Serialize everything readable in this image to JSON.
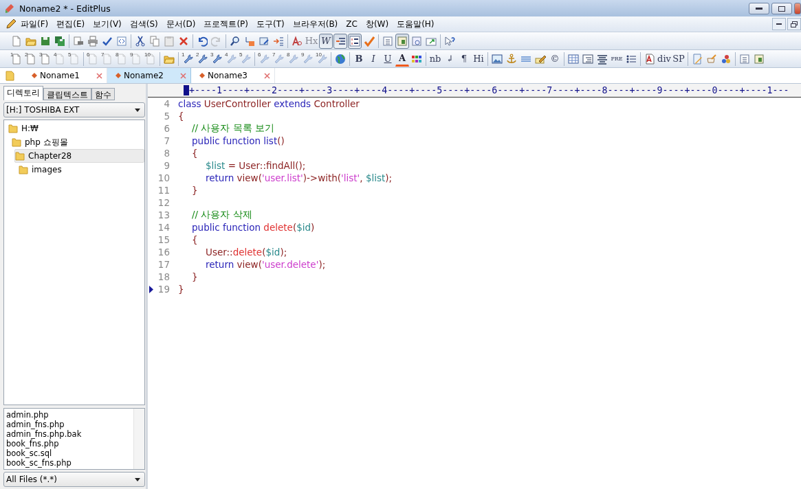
{
  "window": {
    "title": "Noname2 * - EditPlus"
  },
  "menu": [
    "파일(F)",
    "편집(E)",
    "보기(V)",
    "검색(S)",
    "문서(D)",
    "프로젝트(P)",
    "도구(T)",
    "브라우저(B)",
    "ZC",
    "창(W)",
    "도움말(H)"
  ],
  "toolbars": [
    {
      "items": [
        {
          "kind": "icon"
        },
        {
          "kind": "icon"
        },
        {
          "kind": "icon"
        },
        {
          "kind": "icon"
        },
        {
          "kind": "separator"
        },
        {
          "kind": "icon"
        },
        {
          "kind": "icon"
        },
        {
          "kind": "icon"
        },
        {
          "kind": "icon"
        },
        {
          "kind": "separator"
        },
        {
          "kind": "icon"
        },
        {
          "kind": "icon"
        },
        {
          "kind": "icon"
        },
        {
          "kind": "icon"
        },
        {
          "kind": "separator"
        },
        {
          "kind": "icon"
        },
        {
          "kind": "icon",
          "disabled": true
        },
        {
          "kind": "separator"
        },
        {
          "kind": "icon"
        },
        {
          "kind": "icon"
        },
        {
          "kind": "icon"
        },
        {
          "kind": "icon"
        },
        {
          "kind": "separator"
        },
        {
          "kind": "icon"
        },
        {
          "kind": "text",
          "label": "Hx",
          "disabled": true
        },
        {
          "kind": "italic",
          "label": "W",
          "pressed": true
        },
        {
          "kind": "icon",
          "pressed": true
        },
        {
          "kind": "icon",
          "pressed": true
        },
        {
          "kind": "icon"
        },
        {
          "kind": "separator"
        },
        {
          "kind": "icon"
        },
        {
          "kind": "icon",
          "pressed": true
        },
        {
          "kind": "icon"
        },
        {
          "kind": "icon"
        },
        {
          "kind": "separator"
        },
        {
          "kind": "icon"
        }
      ]
    },
    {
      "items": [
        {
          "kind": "numbered",
          "label": "1"
        },
        {
          "kind": "numbered",
          "label": "2"
        },
        {
          "kind": "numbered",
          "label": "3"
        },
        {
          "kind": "numbered",
          "label": "4",
          "disabled": true
        },
        {
          "kind": "numbered",
          "label": "5",
          "disabled": true
        },
        {
          "kind": "separator"
        },
        {
          "kind": "numbered",
          "label": "6",
          "disabled": true
        },
        {
          "kind": "numbered",
          "label": "7",
          "disabled": true
        },
        {
          "kind": "numbered",
          "label": "8",
          "disabled": true
        },
        {
          "kind": "numbered",
          "label": "9",
          "disabled": true
        },
        {
          "kind": "numbered",
          "label": "10",
          "disabled": true
        },
        {
          "kind": "separator"
        },
        {
          "kind": "icon"
        },
        {
          "kind": "separator"
        },
        {
          "kind": "numbered",
          "label": "1"
        },
        {
          "kind": "numbered",
          "label": "2"
        },
        {
          "kind": "numbered",
          "label": "3"
        },
        {
          "kind": "numbered",
          "label": "4",
          "disabled": true
        },
        {
          "kind": "numbered",
          "label": "5",
          "disabled": true
        },
        {
          "kind": "separator"
        },
        {
          "kind": "numbered",
          "label": "6",
          "disabled": true
        },
        {
          "kind": "numbered",
          "label": "7",
          "disabled": true
        },
        {
          "kind": "numbered",
          "label": "8",
          "disabled": true
        },
        {
          "kind": "numbered",
          "label": "9",
          "disabled": true
        },
        {
          "kind": "numbered",
          "label": "10",
          "disabled": true
        },
        {
          "kind": "separator"
        },
        {
          "kind": "icon"
        },
        {
          "kind": "separator"
        },
        {
          "kind": "bold",
          "label": "B"
        },
        {
          "kind": "italic",
          "label": "I"
        },
        {
          "kind": "underline",
          "label": "U"
        },
        {
          "kind": "fontcolor",
          "label": "A"
        },
        {
          "kind": "icon"
        },
        {
          "kind": "separator"
        },
        {
          "kind": "text",
          "label": "nb"
        },
        {
          "kind": "text",
          "label": "↲"
        },
        {
          "kind": "text",
          "label": "¶"
        },
        {
          "kind": "text",
          "label": "Hi"
        },
        {
          "kind": "separator"
        },
        {
          "kind": "icon"
        },
        {
          "kind": "icon"
        },
        {
          "kind": "icon"
        },
        {
          "kind": "icon"
        },
        {
          "kind": "text",
          "label": "©"
        },
        {
          "kind": "separator"
        },
        {
          "kind": "icon"
        },
        {
          "kind": "icon"
        },
        {
          "kind": "icon"
        },
        {
          "kind": "small",
          "label": "PRE"
        },
        {
          "kind": "icon"
        },
        {
          "kind": "separator"
        },
        {
          "kind": "icon"
        },
        {
          "kind": "text",
          "label": "div"
        },
        {
          "kind": "text",
          "label": "SP"
        },
        {
          "kind": "separator"
        },
        {
          "kind": "icon"
        },
        {
          "kind": "icon"
        },
        {
          "kind": "icon"
        },
        {
          "kind": "separator"
        },
        {
          "kind": "icon"
        },
        {
          "kind": "icon"
        }
      ]
    }
  ],
  "doc_tabs": [
    {
      "label": "Noname1",
      "selected": false
    },
    {
      "label": "Noname2",
      "selected": true
    },
    {
      "label": "Noname3",
      "selected": false
    }
  ],
  "sidebar": {
    "tabs": [
      {
        "label": "디렉토리",
        "selected": true
      },
      {
        "label": "클립텍스트",
        "selected": false
      },
      {
        "label": "함수",
        "selected": false
      }
    ],
    "drive": "[H:] TOSHIBA EXT",
    "tree": [
      {
        "label": "H:₩",
        "selected": false,
        "children": [
          {
            "label": "php 쇼핑몰",
            "selected": false,
            "children": [
              {
                "label": "Chapter28",
                "selected": true,
                "children": [
                  {
                    "label": "images",
                    "selected": false
                  }
                ]
              }
            ]
          }
        ]
      }
    ],
    "files": [
      "admin.php",
      "admin_fns.php",
      "admin_fns.php.bak",
      "book_fns.php",
      "book_sc.sql",
      "book_sc_fns.php"
    ],
    "filter": "All Files (*.*)"
  },
  "editor": {
    "ruler": "+----1----+----2----+----3----+----4----+----5----+----6----+----7----+----8----+----9----+----0----+----1---",
    "lines": [
      {
        "number": "4",
        "current": false,
        "tokens": [
          {
            "kind": "keyword",
            "text": "class "
          },
          {
            "kind": "name",
            "text": "UserController "
          },
          {
            "kind": "keyword",
            "text": "extends "
          },
          {
            "kind": "name",
            "text": "Controller"
          }
        ]
      },
      {
        "number": "5",
        "current": false,
        "tokens": [
          {
            "kind": "name",
            "text": "{"
          }
        ]
      },
      {
        "number": "6",
        "current": false,
        "tokens": [
          {
            "kind": "comment",
            "text": "\t// 사용자 목록 보기"
          }
        ]
      },
      {
        "number": "7",
        "current": false,
        "tokens": [
          {
            "kind": "keyword",
            "text": "\tpublic function list"
          },
          {
            "kind": "name",
            "text": "()"
          }
        ]
      },
      {
        "number": "8",
        "current": false,
        "tokens": [
          {
            "kind": "name",
            "text": "\t{"
          }
        ]
      },
      {
        "number": "9",
        "current": false,
        "tokens": [
          {
            "kind": "var",
            "text": "\t\t$list"
          },
          {
            "kind": "name",
            "text": " = User::findAll();"
          }
        ]
      },
      {
        "number": "10",
        "current": false,
        "tokens": [
          {
            "kind": "keyword",
            "text": "\t\treturn "
          },
          {
            "kind": "name",
            "text": "view("
          },
          {
            "kind": "string",
            "text": "'user.list'"
          },
          {
            "kind": "name",
            "text": ")->with("
          },
          {
            "kind": "string",
            "text": "'list'"
          },
          {
            "kind": "name",
            "text": ", "
          },
          {
            "kind": "var",
            "text": "$list"
          },
          {
            "kind": "name",
            "text": ");"
          }
        ]
      },
      {
        "number": "11",
        "current": false,
        "tokens": [
          {
            "kind": "name",
            "text": "\t}"
          }
        ]
      },
      {
        "number": "12",
        "current": false
      },
      {
        "number": "13",
        "current": false,
        "tokens": [
          {
            "kind": "comment",
            "text": "\t// 사용자 삭제"
          }
        ]
      },
      {
        "number": "14",
        "current": false,
        "tokens": [
          {
            "kind": "keyword",
            "text": "\tpublic function "
          },
          {
            "kind": "func",
            "text": "delete"
          },
          {
            "kind": "name",
            "text": "("
          },
          {
            "kind": "var",
            "text": "$id"
          },
          {
            "kind": "name",
            "text": ")"
          }
        ]
      },
      {
        "number": "15",
        "current": false,
        "tokens": [
          {
            "kind": "name",
            "text": "\t{"
          }
        ]
      },
      {
        "number": "16",
        "current": false,
        "tokens": [
          {
            "kind": "name",
            "text": "\t\tUser::"
          },
          {
            "kind": "func",
            "text": "delete"
          },
          {
            "kind": "name",
            "text": "("
          },
          {
            "kind": "var",
            "text": "$id"
          },
          {
            "kind": "name",
            "text": ");"
          }
        ]
      },
      {
        "number": "17",
        "current": false,
        "tokens": [
          {
            "kind": "keyword",
            "text": "\t\treturn "
          },
          {
            "kind": "name",
            "text": "view("
          },
          {
            "kind": "string",
            "text": "'user.delete'"
          },
          {
            "kind": "name",
            "text": ");"
          }
        ]
      },
      {
        "number": "18",
        "current": false,
        "tokens": [
          {
            "kind": "name",
            "text": "\t}"
          }
        ]
      },
      {
        "number": "19",
        "current": true,
        "tokens": [
          {
            "kind": "name",
            "text": "}"
          }
        ]
      }
    ]
  }
}
